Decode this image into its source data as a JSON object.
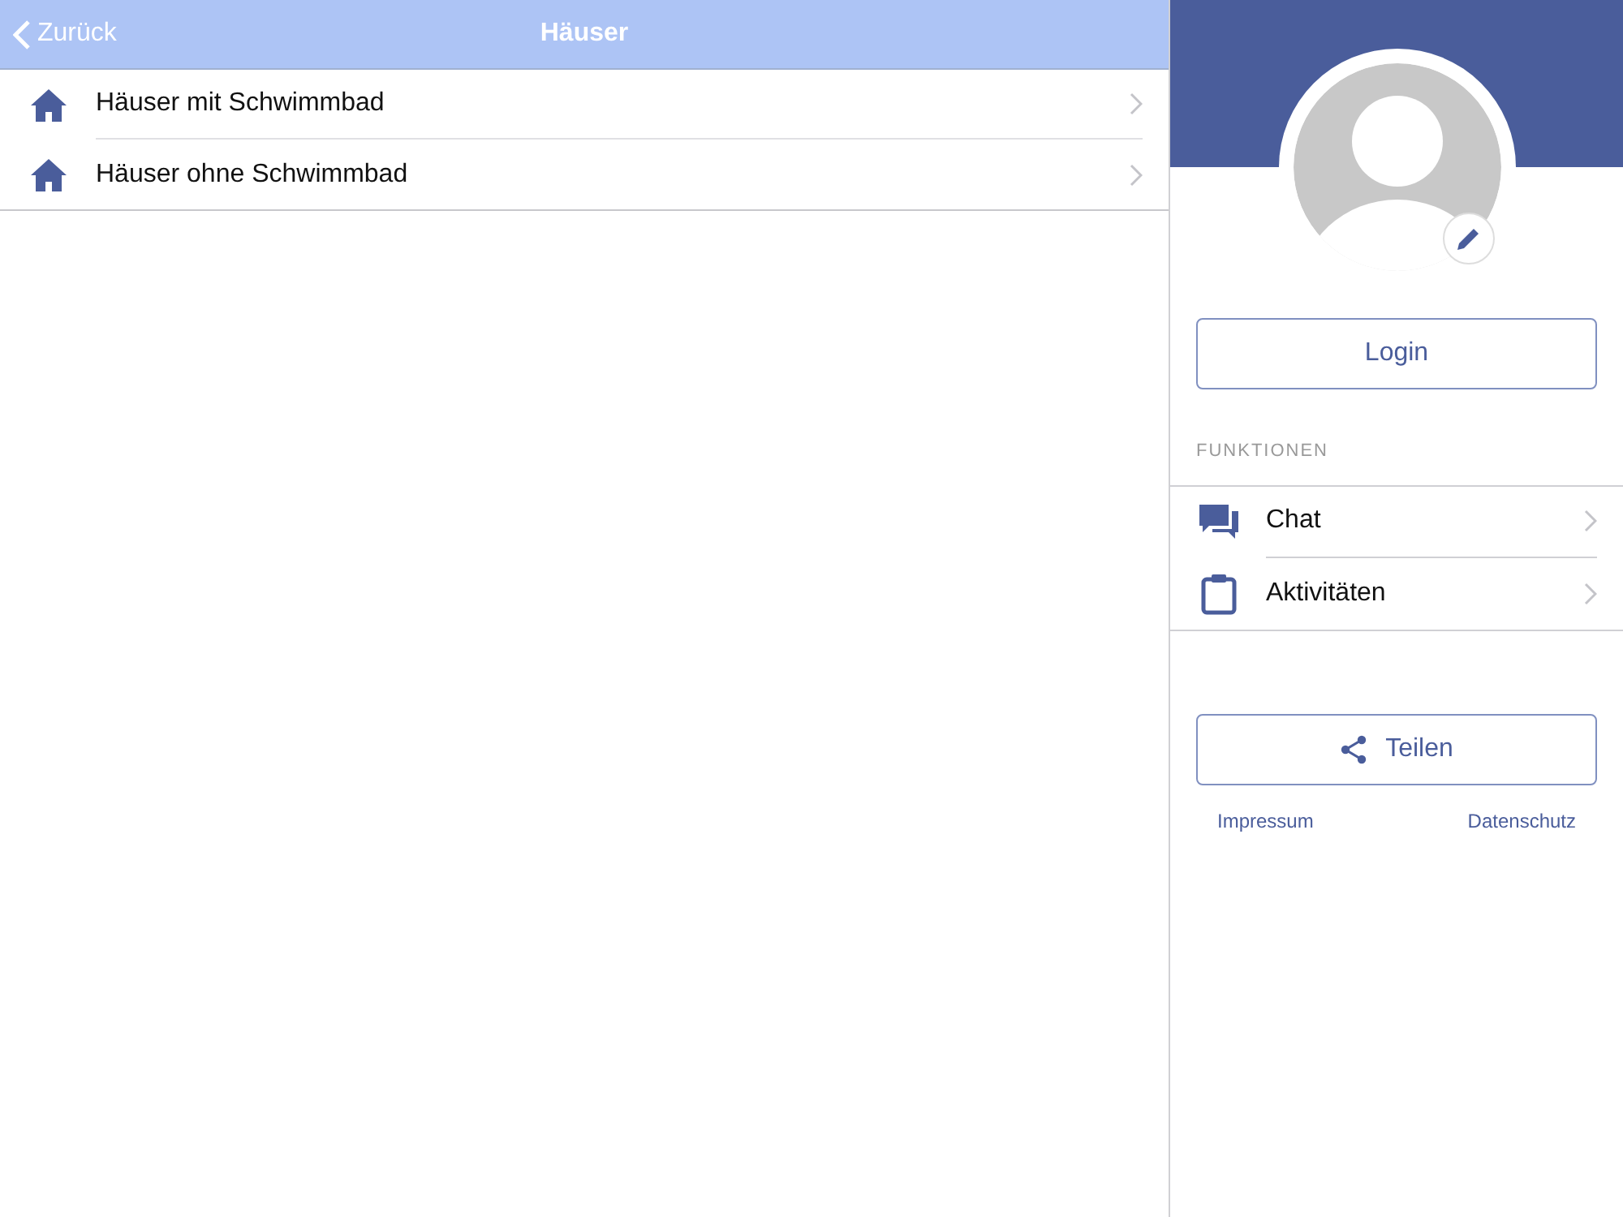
{
  "header": {
    "back": "Zurück",
    "title": "Häuser"
  },
  "list": [
    {
      "label": "Häuser mit Schwimmbad"
    },
    {
      "label": "Häuser ohne Schwimmbad"
    }
  ],
  "profile": {
    "login": "Login"
  },
  "functions": {
    "heading": "FUNKTIONEN",
    "items": [
      {
        "kind": "chat",
        "label": "Chat"
      },
      {
        "kind": "clipboard",
        "label": "Aktivitäten"
      }
    ]
  },
  "share": "Teilen",
  "links": [
    "Impressum",
    "Datenschutz"
  ]
}
